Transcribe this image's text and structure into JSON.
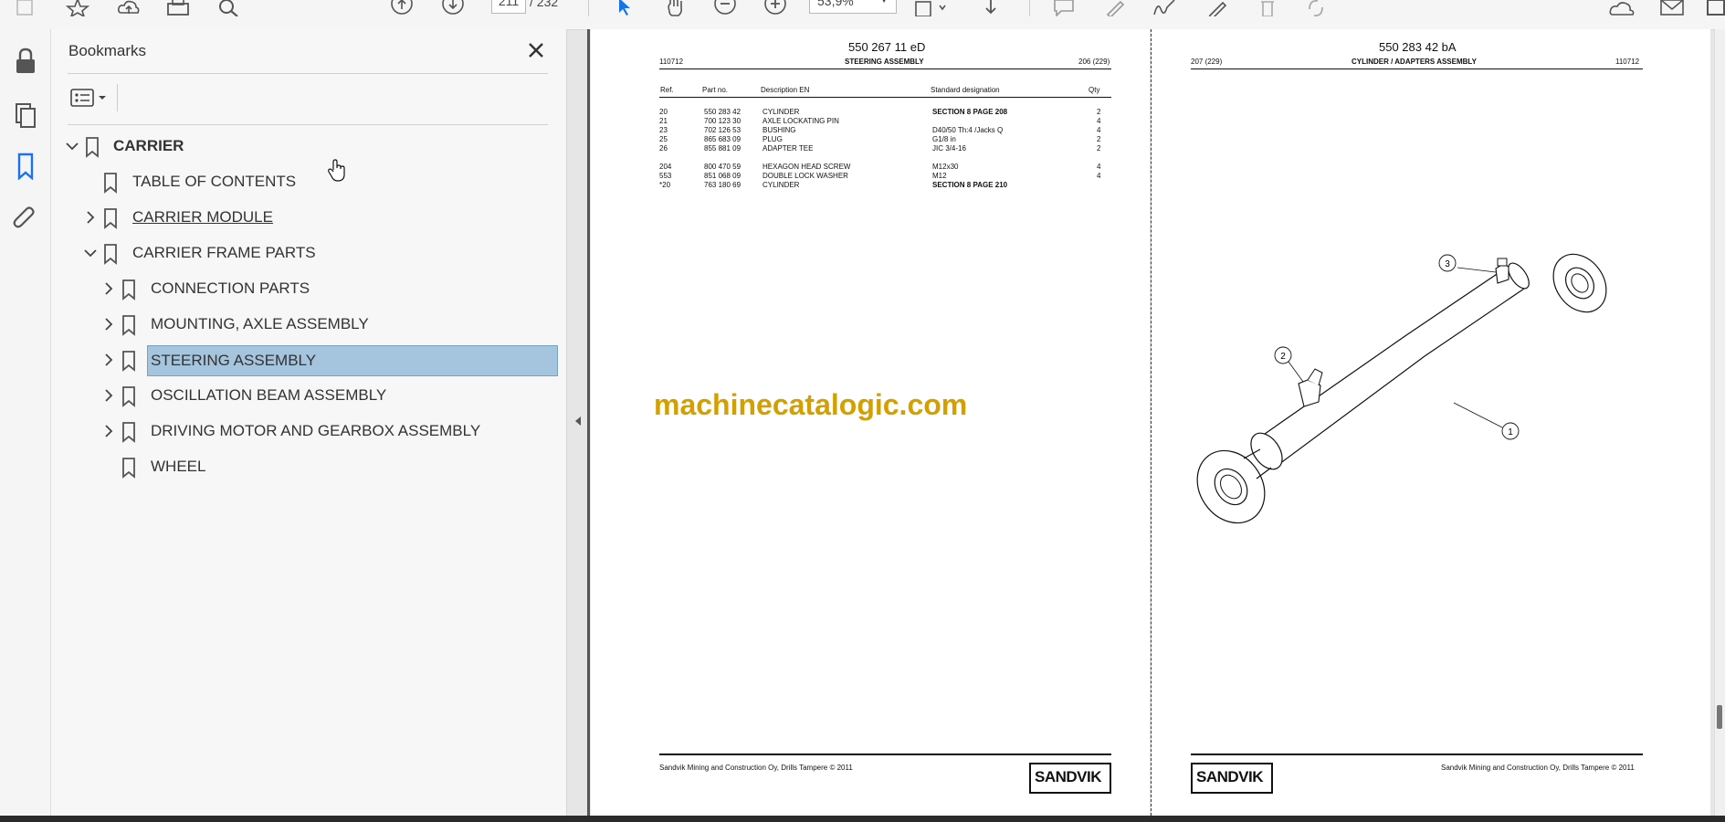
{
  "toolbar": {
    "page_current": "211",
    "page_total": "232",
    "zoom": "53,9%"
  },
  "panel": {
    "title": "Bookmarks",
    "bookmarks": [
      {
        "label": "CARRIER"
      },
      {
        "label": "TABLE OF CONTENTS"
      },
      {
        "label": "CARRIER MODULE"
      },
      {
        "label": "CARRIER FRAME PARTS"
      },
      {
        "label": "CONNECTION PARTS"
      },
      {
        "label": "MOUNTING, AXLE ASSEMBLY"
      },
      {
        "label": "STEERING ASSEMBLY"
      },
      {
        "label": "OSCILLATION BEAM ASSEMBLY"
      },
      {
        "label": "DRIVING MOTOR AND GEARBOX ASSEMBLY"
      },
      {
        "label": "WHEEL"
      }
    ]
  },
  "doc": {
    "left": {
      "doc_no": "550 267 11 eD",
      "date": "110712",
      "title": "STEERING ASSEMBLY",
      "page": "206 (229)",
      "headers": [
        "Ref.",
        "Part no.",
        "Description EN",
        "Standard designation",
        "Qty"
      ],
      "rows": [
        [
          "20",
          "550 283 42",
          "CYLINDER",
          "SECTION 8 PAGE 208",
          "2"
        ],
        [
          "21",
          "700 123 30",
          "AXLE LOCKATING PIN",
          "",
          "4"
        ],
        [
          "23",
          "702 126 53",
          "BUSHING",
          "D40/50 Th:4 /Jacks Q",
          "4"
        ],
        [
          "25",
          "865 683 09",
          "PLUG",
          "G1/8 in",
          "2"
        ],
        [
          "26",
          "855 881 09",
          "ADAPTER TEE",
          "JIC 3/4-16",
          "2"
        ],
        [
          "",
          "",
          "",
          "",
          ""
        ],
        [
          "204",
          "800 470 59",
          "HEXAGON HEAD SCREW",
          "M12x30",
          "4"
        ],
        [
          "553",
          "851 068 09",
          "DOUBLE LOCK WASHER",
          "M12",
          "4"
        ],
        [
          "*20",
          "763 180 69",
          "CYLINDER",
          "SECTION 8 PAGE 210",
          ""
        ]
      ],
      "footer": "Sandvik Mining and Construction Oy, Drills Tampere © 2011",
      "logo": "SANDVIK"
    },
    "right": {
      "doc_no": "550 283 42 bA",
      "page": "207 (229)",
      "title": "CYLINDER / ADAPTERS ASSEMBLY",
      "date": "110712",
      "callouts": [
        "3",
        "2",
        "1"
      ],
      "footer": "Sandvik Mining and Construction Oy, Drills Tampere © 2011",
      "logo": "SANDVIK"
    },
    "watermark": "machinecatalogic.com"
  }
}
